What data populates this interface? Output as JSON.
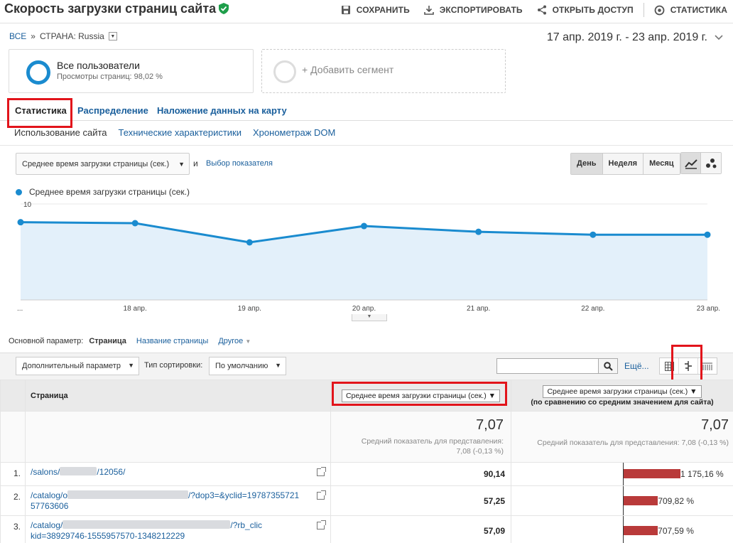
{
  "header": {
    "title": "Скорость загрузки страниц сайта",
    "actions": {
      "save": "СОХРАНИТЬ",
      "export": "ЭКСПОРТИРОВАТЬ",
      "share": "ОТКРЫТЬ ДОСТУП",
      "insights": "СТАТИСТИКА"
    }
  },
  "breadcrumb": {
    "all": "ВСЕ",
    "sep": "»",
    "country": "СТРАНА: Russia"
  },
  "date_range": "17 апр. 2019 г. - 23 апр. 2019 г.",
  "segments": {
    "active": {
      "title": "Все пользователи",
      "subtitle": "Просмотры страниц: 98,02 %"
    },
    "add": "+ Добавить сегмент"
  },
  "tabs": [
    "Статистика",
    "Распределение",
    "Наложение данных на карту"
  ],
  "subtabs": [
    "Использование сайта",
    "Технические характеристики",
    "Хронометраж DOM"
  ],
  "chart_controls": {
    "metric": "Среднее время загрузки страницы (сек.)",
    "and": "и",
    "pick_metric": "Выбор показателя",
    "periods": [
      "День",
      "Неделя",
      "Месяц"
    ]
  },
  "chart_data": {
    "type": "area",
    "legend": "Среднее время загрузки страницы (сек.)",
    "x": [
      "...",
      "18 апр.",
      "19 апр.",
      "20 апр.",
      "21 апр.",
      "22 апр.",
      "23 апр."
    ],
    "series": [
      {
        "name": "Среднее время загрузки страницы (сек.)",
        "values": [
          8.1,
          8.0,
          6.0,
          7.7,
          7.1,
          6.8,
          6.8
        ]
      }
    ],
    "yticks": [
      "10",
      "5"
    ],
    "ylim": [
      0,
      10
    ],
    "color": "#1a8bcf",
    "fill": "#e3f0fa"
  },
  "dimension": {
    "label": "Основной параметр:",
    "page": "Страница",
    "page_title": "Название страницы",
    "other": "Другое"
  },
  "toolbar": {
    "secondary": "Дополнительный параметр",
    "sort_label": "Тип сортировки:",
    "sort_value": "По умолчанию",
    "more": "Ещё..."
  },
  "table": {
    "col_page": "Страница",
    "col_metric": "Среднее время загрузки страницы (сек.)",
    "col_compare": "Среднее время загрузки страницы (сек.)",
    "col_compare_sub": "(по сравнению со средним значением для сайта)",
    "total_value": "7,07",
    "total_note1": "Средний показатель для представления:",
    "total_note2": "7,08 (-0,13 %)",
    "total_compare_note": "Средний показатель для представления: 7,08 (-0,13 %)",
    "rows": [
      {
        "n": "1.",
        "pre": "/salons/",
        "post": "/12056/",
        "post2": "",
        "value": "90,14",
        "pct": "1 175,16 %",
        "bar": 1175.16
      },
      {
        "n": "2.",
        "pre": "/catalog/o",
        "post": "/?dop3=&yclid=19787355721",
        "post2": "57763606",
        "value": "57,25",
        "pct": "709,82 %",
        "bar": 709.82
      },
      {
        "n": "3.",
        "pre": "/catalog/",
        "post": "/?rb_clic",
        "post2": "kid=38929746-1555957570-1348212229",
        "value": "57,09",
        "pct": "707,59 %",
        "bar": 707.59
      }
    ]
  }
}
